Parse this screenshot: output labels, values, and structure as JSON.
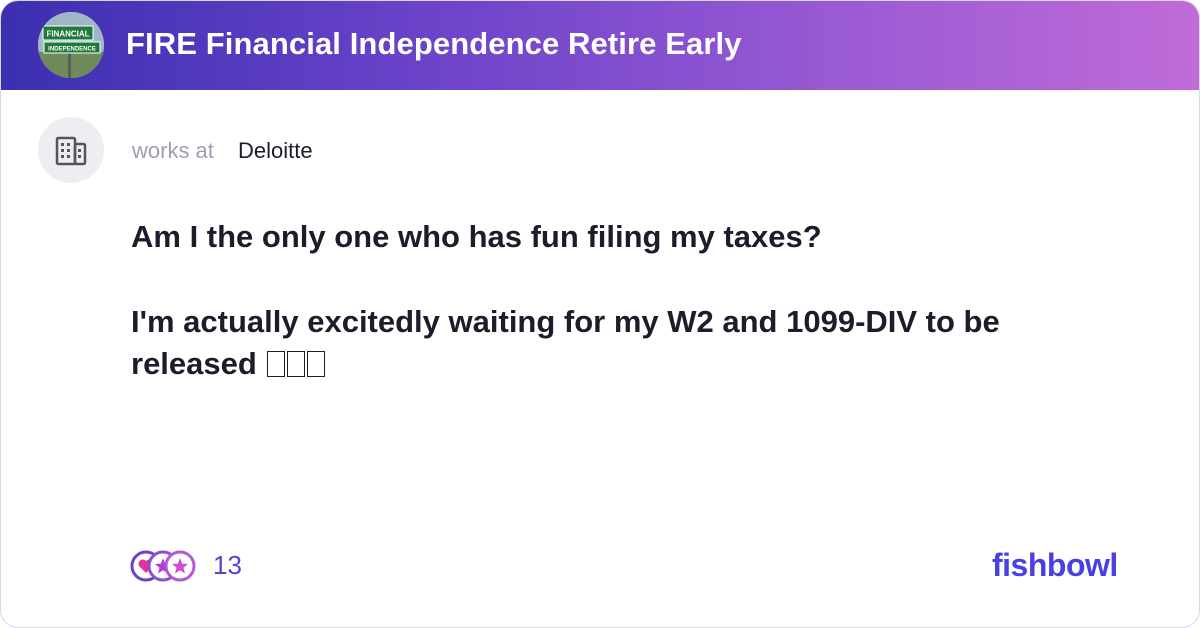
{
  "header": {
    "title": "FIRE Financial Independence Retire Early",
    "avatar_sign_text": [
      "FINANCIAL",
      "INDEPENDENCE"
    ]
  },
  "author": {
    "works_at_label": "works at",
    "company": "Deloitte",
    "icon": "building-icon"
  },
  "post": {
    "title": "Am I the only one who has fun filing my taxes?",
    "body": "I'm actually excitedly waiting for my W2 and 1099-DIV to be released",
    "emoji_count": 3
  },
  "reactions": {
    "count": "13",
    "icons": [
      "heart-reaction-icon",
      "star-reaction-icon",
      "star-reaction-icon"
    ]
  },
  "brand": {
    "logo_text": "fishbowl"
  },
  "colors": {
    "header_gradient_start": "#3b2fb0",
    "header_gradient_end": "#c06bd8",
    "text_primary": "#1d1c2b",
    "text_muted": "#a09eb0",
    "accent": "#5a3fd0",
    "brand": "#4a3fe0"
  }
}
